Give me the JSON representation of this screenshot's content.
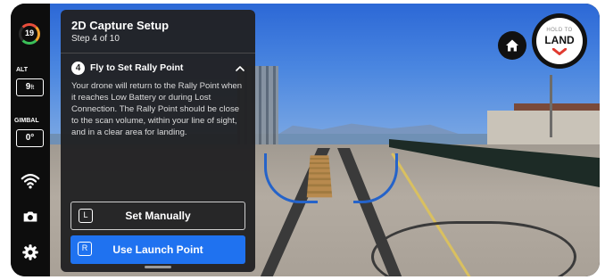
{
  "status": {
    "battery": "19",
    "altitude": {
      "label": "ALT",
      "value": "9",
      "unit": "ft"
    },
    "gimbal": {
      "label": "GIMBAL",
      "value": "0",
      "unit": "°"
    }
  },
  "side_icons": [
    "wifi-signal-icon",
    "camera-icon",
    "settings-gear-icon"
  ],
  "panel": {
    "title": "2D Capture Setup",
    "step": "Step 4 of 10",
    "section": {
      "number": "4",
      "title": "Fly to Set Rally Point",
      "body": "Your drone will return to the Rally Point when it reaches Low Battery or during Lost Connection. The Rally Point should be close to the scan volume, within your line of sight, and in a clear area for landing."
    },
    "buttons": {
      "manual": {
        "key": "L",
        "label": "Set Manually"
      },
      "launch": {
        "key": "R",
        "label": "Use Launch Point"
      }
    }
  },
  "hold_to_land": {
    "small": "HOLD TO",
    "big": "LAND"
  },
  "colors": {
    "accent": "#1f72f0",
    "land_chevron": "#e03a2f",
    "battery_red": "#e84d3b",
    "battery_green": "#3bbf58"
  }
}
